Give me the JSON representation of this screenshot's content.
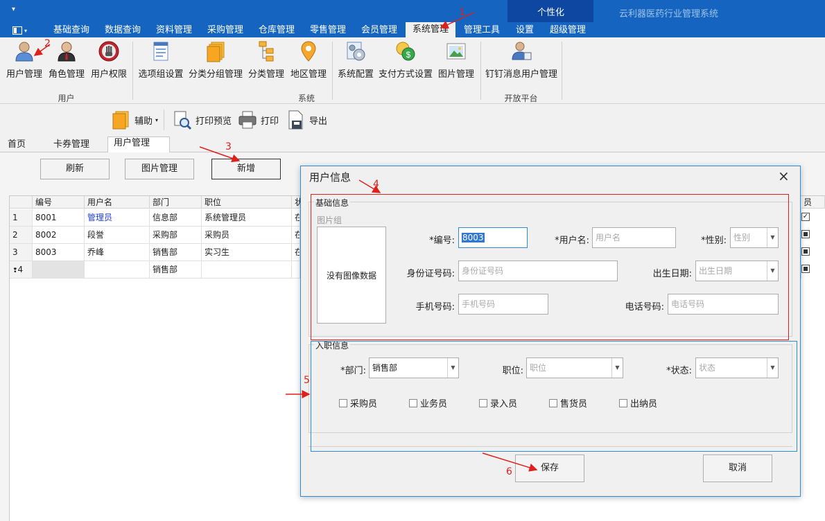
{
  "titlebar": {
    "qat_label": "▾",
    "ribbon_toggle": "▾",
    "personalize_label": "个性化",
    "app_title": "云利器医药行业管理系统",
    "menu_tabs": [
      {
        "label": "基础查询"
      },
      {
        "label": "数据查询"
      },
      {
        "label": "资料管理"
      },
      {
        "label": "采购管理"
      },
      {
        "label": "仓库管理"
      },
      {
        "label": "零售管理"
      },
      {
        "label": "会员管理"
      },
      {
        "label": "系统管理"
      },
      {
        "label": "管理工具"
      },
      {
        "label": "设置"
      },
      {
        "label": "超级管理"
      }
    ]
  },
  "ribbon": {
    "buttons": [
      {
        "label": "用户管理"
      },
      {
        "label": "角色管理"
      },
      {
        "label": "用户权限"
      },
      {
        "label": "选项组设置"
      },
      {
        "label": "分类分组管理"
      },
      {
        "label": "分类管理"
      },
      {
        "label": "地区管理"
      },
      {
        "label": "系统配置"
      },
      {
        "label": "支付方式设置"
      },
      {
        "label": "图片管理"
      },
      {
        "label": "钉钉消息用户管理"
      }
    ],
    "groups": [
      {
        "label": "用户"
      },
      {
        "label": "系统"
      },
      {
        "label": "开放平台"
      }
    ]
  },
  "toolbar2": {
    "assist_label": "辅助",
    "print_preview_label": "打印预览",
    "print_label": "打印",
    "export_label": "导出"
  },
  "doc_tabs": [
    {
      "label": "首页"
    },
    {
      "label": "卡券管理"
    },
    {
      "label": "用户管理"
    }
  ],
  "doc_tab_close": "×",
  "page_buttons": {
    "refresh": "刷新",
    "image_manage": "图片管理",
    "add": "新增"
  },
  "grid": {
    "headers": [
      "编号",
      "用户名",
      "部门",
      "职位",
      "状"
    ],
    "rows": [
      {
        "rownum": "1",
        "code": "8001",
        "name": "管理员",
        "dept": "信息部",
        "position": "系统管理员",
        "status": "在"
      },
      {
        "rownum": "2",
        "code": "8002",
        "name": "段誉",
        "dept": "采购部",
        "position": "采购员",
        "status": "在"
      },
      {
        "rownum": "3",
        "code": "8003",
        "name": "乔峰",
        "dept": "销售部",
        "position": "实习生",
        "status": "在"
      },
      {
        "rownum": "4",
        "code": "",
        "name": "",
        "dept": "销售部",
        "position": "",
        "status": ""
      }
    ],
    "right_header": "员"
  },
  "dialog": {
    "title": "用户信息",
    "close": "×",
    "basic_legend": "基础信息",
    "image_group_label": "图片组",
    "no_image_text": "没有图像数据",
    "code_label": "*编号:",
    "code_value": "8003",
    "username_label": "*用户名:",
    "username_placeholder": "用户名",
    "gender_label": "*性别:",
    "gender_placeholder": "性别",
    "idcard_label": "身份证号码:",
    "idcard_placeholder": "身份证号码",
    "birth_label": "出生日期:",
    "birth_placeholder": "出生日期",
    "mobile_label": "手机号码:",
    "mobile_placeholder": "手机号码",
    "phone_label": "电话号码:",
    "phone_placeholder": "电话号码",
    "job_legend": "入职信息",
    "dept_label": "*部门:",
    "dept_value": "销售部",
    "position_label": "职位:",
    "position_placeholder": "职位",
    "status_label": "*状态:",
    "status_placeholder": "状态",
    "checkboxes": [
      {
        "label": "采购员"
      },
      {
        "label": "业务员"
      },
      {
        "label": "录入员"
      },
      {
        "label": "售货员"
      },
      {
        "label": "出纳员"
      }
    ],
    "save_label": "保存",
    "cancel_label": "取消"
  },
  "annotations": {
    "n1": "1",
    "n2": "2",
    "n3": "3",
    "n4": "4",
    "n5": "5",
    "n6": "6"
  },
  "colors": {
    "titlebar": "#1565c0",
    "personalize_bg": "#0d47a1",
    "annotation": "#e0201a",
    "highlight_blue": "#2f8ad6"
  }
}
